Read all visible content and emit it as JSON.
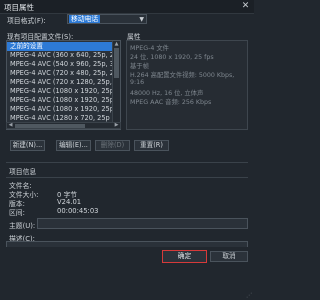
{
  "window": {
    "title": "项目属性",
    "close": "✕"
  },
  "format": {
    "label": "项目格式(F):",
    "value": "移动电话"
  },
  "profiles": {
    "label": "现有项目配置文件(S):",
    "items": [
      "之前的设置",
      "MPEG-4 AVC (360 x 640, 25p, 2.5",
      "MPEG-4 AVC (540 x 960, 25p, 3M",
      "MPEG-4 AVC (720 x 480, 25p, 2.5",
      "MPEG-4 AVC (720 x 1280, 25p, 4",
      "MPEG-4 AVC (1080 x 1920, 25p",
      "MPEG-4 AVC (1080 x 1920, 25p",
      "MPEG-4 AVC (1080 x 1920, 25p",
      "MPEG-4 AVC (1280 x 720, 25p"
    ],
    "selected_index": 0
  },
  "properties": {
    "label": "属性",
    "lines": [
      "MPEG-4 文件",
      "24 位, 1080 x 1920, 25 fps",
      "基于帧",
      "H.264 高配置文件视频: 5000 Kbps,",
      "9:16",
      "48000 Hz, 16 位, 立体声",
      "MPEG AAC 音频: 256 Kbps"
    ]
  },
  "buttons": {
    "new": "新建(N)...",
    "edit": "编辑(E)...",
    "delete": "删除(D)",
    "reset": "重置(R)",
    "ok": "确定",
    "cancel": "取消"
  },
  "project_info": {
    "section_label": "项目信息",
    "filename_label": "文件名:",
    "filename_value": "",
    "filesize_label": "文件大小:",
    "filesize_value": "0 字节",
    "version_label": "版本:",
    "version_value": "V24.01",
    "duration_label": "区间:",
    "duration_value": "00:00:45:03",
    "subject_label": "主题(U):",
    "subject_value": "",
    "description_label": "描述(C):",
    "description_value": ""
  },
  "icons": {
    "dropdown": "caret-down-icon",
    "scroll_up": "caret-up-icon",
    "scroll_down": "caret-down-icon"
  }
}
